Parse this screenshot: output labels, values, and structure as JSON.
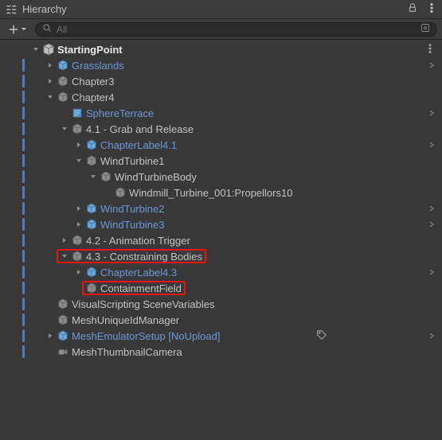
{
  "header": {
    "title": "Hierarchy"
  },
  "search": {
    "placeholder": "All"
  },
  "scene": {
    "name": "StartingPoint"
  },
  "rows": [
    {
      "label": "StartingPoint",
      "cls": "bold",
      "depth": 0,
      "icon": "scene",
      "arrow": "down",
      "bar": false,
      "chev": false,
      "dots": true
    },
    {
      "label": "Grasslands",
      "cls": "blue",
      "depth": 1,
      "icon": "cubeB",
      "arrow": "right",
      "bar": true,
      "chev": true
    },
    {
      "label": "Chapter3",
      "cls": "gray",
      "depth": 1,
      "icon": "cubeG",
      "arrow": "right",
      "bar": true,
      "chev": false
    },
    {
      "label": "Chapter4",
      "cls": "gray",
      "depth": 1,
      "icon": "cubeG",
      "arrow": "down",
      "bar": true,
      "chev": false
    },
    {
      "label": "SphereTerrace",
      "cls": "blue",
      "depth": 2,
      "icon": "script",
      "arrow": "blank",
      "bar": true,
      "chev": true
    },
    {
      "label": "4.1 - Grab and Release",
      "cls": "gray",
      "depth": 2,
      "icon": "cubeG",
      "arrow": "down",
      "bar": true,
      "chev": false
    },
    {
      "label": "ChapterLabel4.1",
      "cls": "blue",
      "depth": 3,
      "icon": "cubeB",
      "arrow": "right",
      "bar": true,
      "chev": true
    },
    {
      "label": "WindTurbine1",
      "cls": "gray",
      "depth": 3,
      "icon": "cubeG",
      "arrow": "down",
      "bar": true,
      "chev": false
    },
    {
      "label": "WindTurbineBody",
      "cls": "gray",
      "depth": 4,
      "icon": "cubeG",
      "arrow": "down",
      "bar": true,
      "chev": false
    },
    {
      "label": "Windmill_Turbine_001:Propellors10",
      "cls": "gray",
      "depth": 5,
      "icon": "cubeG",
      "arrow": "blank",
      "bar": true,
      "chev": false
    },
    {
      "label": "WindTurbine2",
      "cls": "blue",
      "depth": 3,
      "icon": "cubeB",
      "arrow": "right",
      "bar": true,
      "chev": true
    },
    {
      "label": "WindTurbine3",
      "cls": "blue",
      "depth": 3,
      "icon": "cubeB",
      "arrow": "right",
      "bar": true,
      "chev": true
    },
    {
      "label": "4.2 - Animation Trigger",
      "cls": "gray",
      "depth": 2,
      "icon": "cubeG",
      "arrow": "right",
      "bar": true,
      "chev": false
    },
    {
      "label": "4.3 - Constraining Bodies",
      "cls": "gray",
      "depth": 2,
      "icon": "cubeG",
      "arrow": "down",
      "bar": true,
      "chev": false,
      "hlGroup": true
    },
    {
      "label": "ChapterLabel4.3",
      "cls": "blue",
      "depth": 3,
      "icon": "cubeB",
      "arrow": "right",
      "bar": true,
      "chev": true
    },
    {
      "label": "ContainmentField",
      "cls": "gray",
      "depth": 3,
      "icon": "cubeG",
      "arrow": "blank",
      "bar": true,
      "chev": false,
      "hlItem": true
    },
    {
      "label": "VisualScripting SceneVariables",
      "cls": "gray",
      "depth": 1,
      "icon": "cubeG",
      "arrow": "blank",
      "bar": true,
      "chev": false
    },
    {
      "label": "MeshUniqueIdManager",
      "cls": "gray",
      "depth": 1,
      "icon": "cubeG",
      "arrow": "blank",
      "bar": true,
      "chev": false
    },
    {
      "label": "MeshEmulatorSetup [NoUpload]",
      "cls": "blue",
      "depth": 1,
      "icon": "cubeB",
      "arrow": "right",
      "bar": true,
      "chev": true,
      "tag": true
    },
    {
      "label": "MeshThumbnailCamera",
      "cls": "gray",
      "depth": 1,
      "icon": "cam",
      "arrow": "blank",
      "bar": true,
      "chev": false
    }
  ]
}
